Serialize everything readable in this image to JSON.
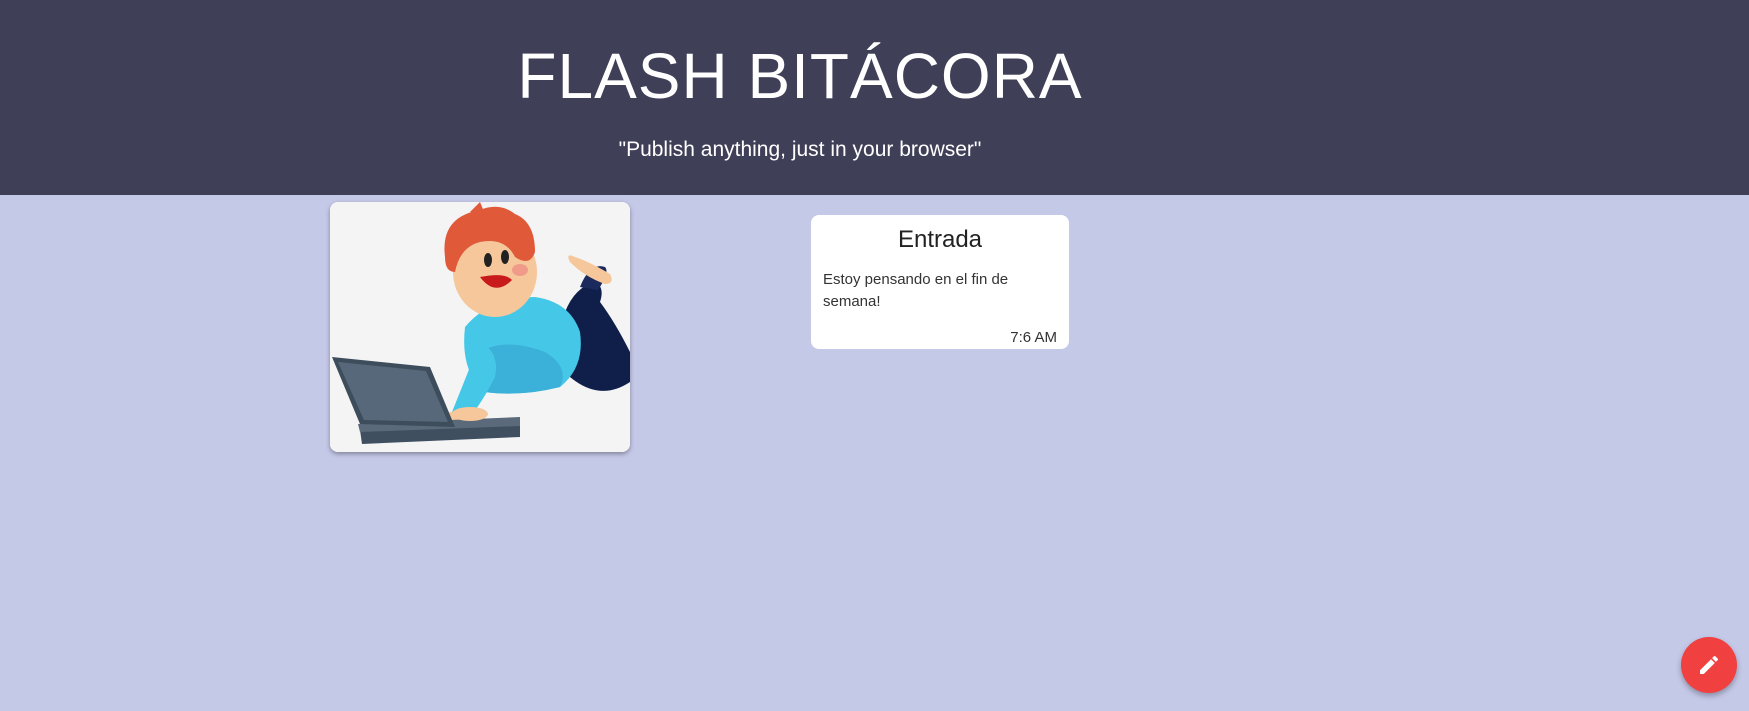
{
  "header": {
    "title": "FLASH BITÁCORA",
    "tagline": "\"Publish anything, just in your browser\""
  },
  "posts": [
    {
      "title": "Entrada",
      "body": "Estoy pensando en el fin de semana!",
      "time": "7:6 AM"
    }
  ],
  "fab": {
    "icon": "pencil-icon",
    "color": "#f04040"
  },
  "colors": {
    "header_bg": "#3f3f58",
    "page_bg": "#c5c9e8"
  }
}
